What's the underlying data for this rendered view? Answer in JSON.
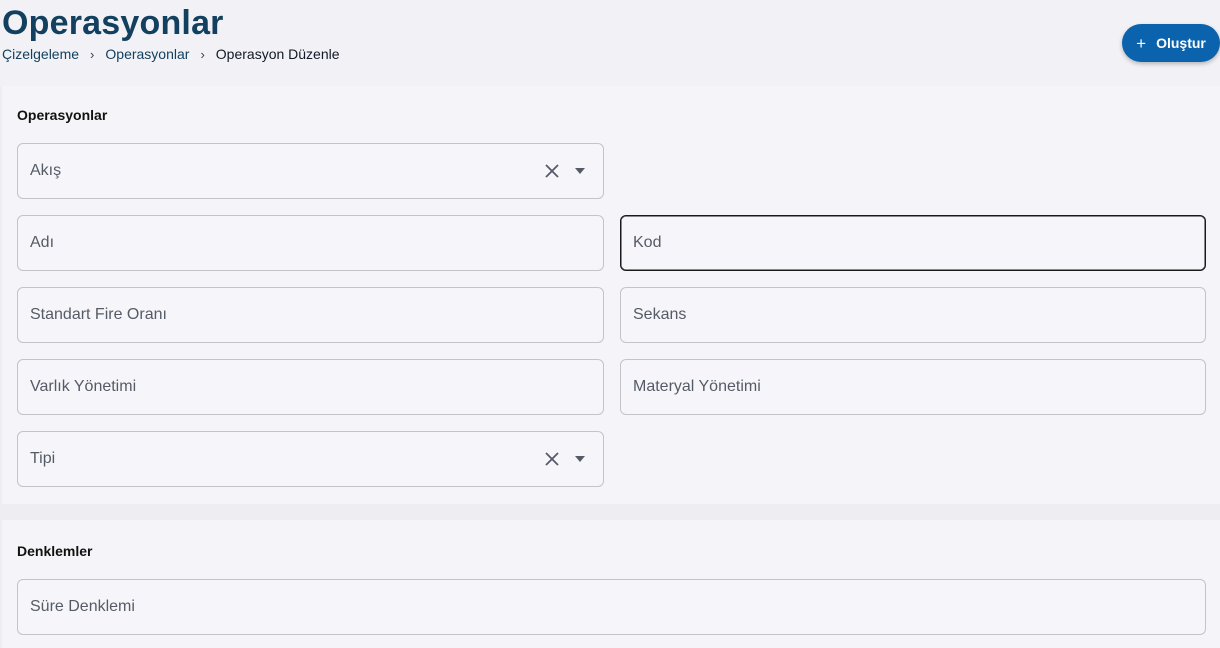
{
  "header": {
    "title": "Operasyonlar",
    "breadcrumb": {
      "items": [
        "Çizelgeleme",
        "Operasyonlar",
        "Operasyon Düzenle"
      ],
      "separator": "›"
    },
    "create_button": {
      "icon": "plus-icon",
      "label": "Oluştur"
    }
  },
  "operations_section": {
    "title": "Operasyonlar",
    "fields": {
      "flow": {
        "label": "Akış",
        "type": "select",
        "clear_icon": "close-icon",
        "dropdown_icon": "caret-down-icon"
      },
      "name": {
        "label": "Adı"
      },
      "code": {
        "label": "Kod",
        "focused": true
      },
      "scrap_rate": {
        "label": "Standart Fire Oranı"
      },
      "sequence": {
        "label": "Sekans"
      },
      "asset_management": {
        "label": "Varlık Yönetimi"
      },
      "material_management": {
        "label": "Materyal Yönetimi"
      },
      "type": {
        "label": "Tipi",
        "type": "select",
        "clear_icon": "close-icon",
        "dropdown_icon": "caret-down-icon"
      }
    }
  },
  "equations_section": {
    "title": "Denklemler",
    "fields": {
      "duration_equation": {
        "label": "Süre Denklemi"
      }
    }
  },
  "colors": {
    "title": "#13405f",
    "primary_button": "#0b63ae",
    "background": "#eeeef2",
    "card": "#f5f5f9",
    "field_border": "#c4c4c8",
    "focused_border": "#1a1a1a"
  }
}
